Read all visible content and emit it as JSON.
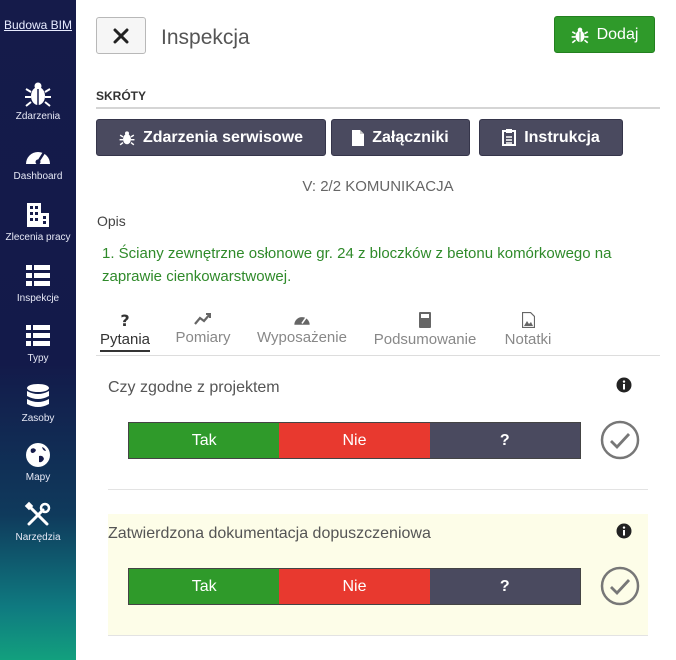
{
  "sidebar": {
    "brand": "Budowa BIM",
    "items": [
      {
        "label": "Zdarzenia",
        "icon": "bug-icon"
      },
      {
        "label": "Dashboard",
        "icon": "speedometer-icon"
      },
      {
        "label": "Zlecenia pracy",
        "icon": "building-icon"
      },
      {
        "label": "Inspekcje",
        "icon": "checklist-icon"
      },
      {
        "label": "Typy",
        "icon": "list-icon"
      },
      {
        "label": "Zasoby",
        "icon": "database-icon"
      },
      {
        "label": "Mapy",
        "icon": "globe-icon"
      },
      {
        "label": "Narzędzia",
        "icon": "tools-icon"
      }
    ]
  },
  "header": {
    "title": "Inspekcja",
    "add_label": "Dodaj",
    "close_icon": "close-icon"
  },
  "shortcuts": {
    "heading": "SKRÓTY",
    "buttons": [
      {
        "label": "Zdarzenia serwisowe",
        "icon": "bug-icon"
      },
      {
        "label": "Załączniki",
        "icon": "file-icon"
      },
      {
        "label": "Instrukcja",
        "icon": "clipboard-icon"
      }
    ]
  },
  "version": "V: 2/2 KOMUNIKACJA",
  "description": {
    "label": "Opis",
    "text": "1. Ściany zewnętrzne osłonowe gr. 24 z bloczków z betonu komórkowego na zaprawie cienkowarstwowej."
  },
  "tabs": [
    {
      "label": "Pytania",
      "icon": "question-icon",
      "active": true
    },
    {
      "label": "Pomiary",
      "icon": "trend-icon"
    },
    {
      "label": "Wyposażenie",
      "icon": "speedometer-icon"
    },
    {
      "label": "Podsumowanie",
      "icon": "book-icon"
    },
    {
      "label": "Notatki",
      "icon": "image-file-icon"
    }
  ],
  "questions": [
    {
      "text": "Czy zgodne z projektem",
      "yes": "Tak",
      "no": "Nie",
      "unknown": "?"
    },
    {
      "text": "Zatwierdzona dokumentacja dopuszczeniowa",
      "yes": "Tak",
      "no": "Nie",
      "unknown": "?"
    }
  ],
  "colors": {
    "success": "#2f9a2a",
    "danger": "#e8392f",
    "dark": "#4a4a5f",
    "description_text": "#2f8a2a",
    "highlight": "#fdfde8"
  }
}
